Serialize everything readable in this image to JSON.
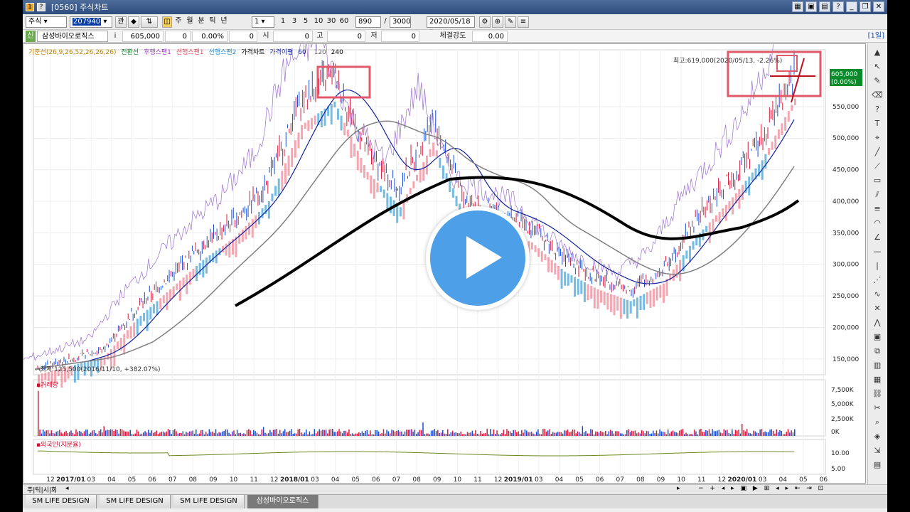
{
  "window": {
    "title": "[0560] 주식차트"
  },
  "toolbar": {
    "market": "주식",
    "code": "207940",
    "btn_related": "관",
    "periods": [
      "주",
      "월",
      "분",
      "틱",
      "년"
    ],
    "interval": "1",
    "quick_intervals": [
      "1",
      "3",
      "5",
      "10",
      "30",
      "60"
    ],
    "count": "890",
    "separator": "/",
    "max_count": "3000",
    "date": "2020/05/18"
  },
  "stock": {
    "tag": "신",
    "name": "삼성바이오로직스",
    "info": "i",
    "price": "605,000",
    "change": "0",
    "rate": "0.00%",
    "volume": "0",
    "open_label": "시",
    "open": "0",
    "high_label": "고",
    "high": "0",
    "low_label": "저",
    "low": "0",
    "strength_label": "체결강도",
    "strength": "0.00",
    "timeframe": "[1일]"
  },
  "legend": {
    "base": "기준선(26,9,26,52,26,26,26)",
    "conv": "전환선",
    "lag": "후행스팬1",
    "lead1": "선행스팬1",
    "lead2": "선행스팬2",
    "price": "가격차트",
    "ma": "가격이평",
    "ma_vals": [
      "60",
      "120",
      "240"
    ]
  },
  "annotations": {
    "high": "최고:619,000(2020/05/13, -2.26%)",
    "low": "최저:125,500(2016/11/10, +382.07%)"
  },
  "price_axis": {
    "current": "605,000",
    "current_rate": "(0.00%)",
    "ticks": [
      "550,000",
      "500,000",
      "450,000",
      "400,000",
      "350,000",
      "300,000",
      "250,000",
      "200,000",
      "150,000"
    ]
  },
  "volume_panel": {
    "title": "거래량",
    "ticks": [
      "7,500K",
      "5,000K",
      "2,500K",
      "0K"
    ]
  },
  "foreign_panel": {
    "title": "외국인(지분율)",
    "ticks": [
      "10.00",
      "5.00"
    ]
  },
  "x_axis": [
    "12",
    "2017/01",
    "03",
    "04",
    "05",
    "06",
    "07",
    "08",
    "09",
    "10",
    "11",
    "12",
    "2018/01",
    "03",
    "04",
    "05",
    "06",
    "07",
    "08",
    "09",
    "10",
    "11",
    "12",
    "2019/01",
    "03",
    "04",
    "05",
    "06",
    "07",
    "08",
    "09",
    "10",
    "11",
    "12",
    "2020/01",
    "03",
    "04",
    "05",
    "06"
  ],
  "bottom": {
    "label": "주|틱|시|회"
  },
  "tabs": [
    "SM LIFE DESIGN",
    "SM LIFE DESIGN",
    "SM LIFE DESIGN",
    "삼성바이오로직스"
  ],
  "colors": {
    "up": "#d81b3a",
    "down": "#1a4fd0",
    "cloud_up": "#f08090",
    "cloud_down": "#3aa0d8",
    "ma_blue": "#1020a0",
    "ma_gray": "#808080",
    "trend": "#000000",
    "marker": "#e05a6a",
    "play": "#4da0e8"
  },
  "chart_data": {
    "type": "line",
    "title": "",
    "ylim": [
      125000,
      640000
    ],
    "x": [
      "2016/11",
      "2017/01",
      "2017/03",
      "2017/05",
      "2017/07",
      "2017/09",
      "2017/11",
      "2018/01",
      "2018/03",
      "2018/04",
      "2018/05",
      "2018/07",
      "2018/09",
      "2018/11",
      "2019/01",
      "2019/03",
      "2019/05",
      "2019/07",
      "2019/08",
      "2019/10",
      "2019/12",
      "2020/01",
      "2020/03",
      "2020/05"
    ],
    "series": [
      {
        "values": [
          135000,
          150000,
          165000,
          230000,
          280000,
          330000,
          370000,
          430000,
          560000,
          600000,
          480000,
          420000,
          530000,
          400000,
          380000,
          360000,
          310000,
          280000,
          260000,
          290000,
          370000,
          430000,
          500000,
          605000
        ]
      }
    ]
  }
}
